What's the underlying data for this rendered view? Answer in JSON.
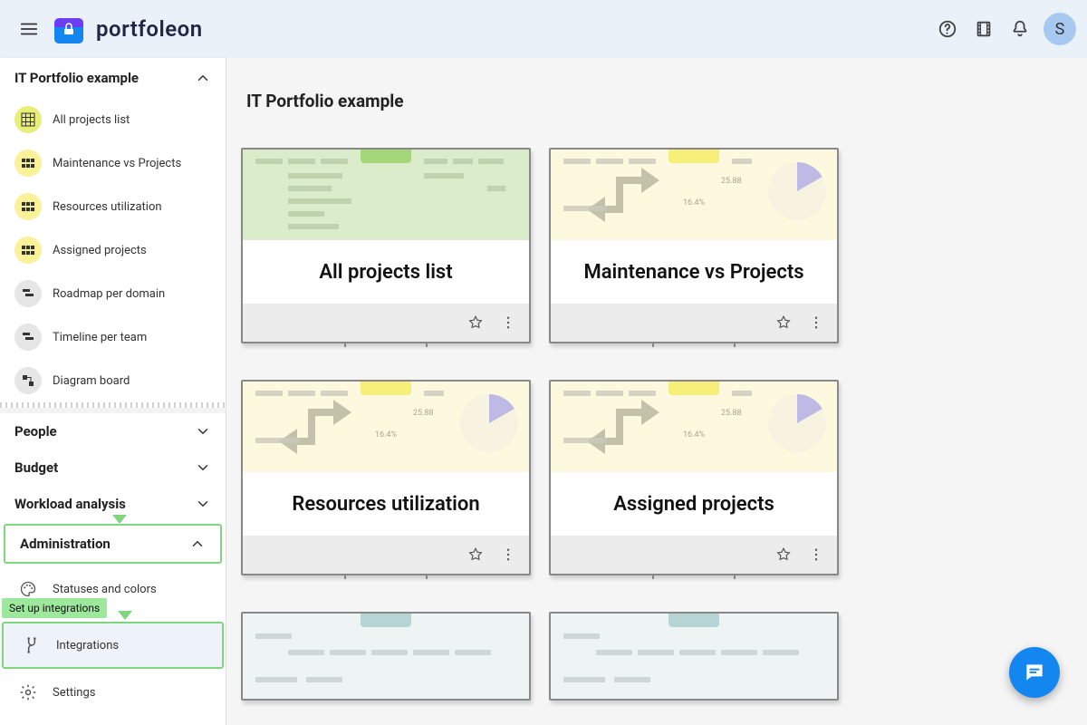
{
  "header": {
    "brand_text": "portfoleon",
    "avatar_initial": "S"
  },
  "sidebar": {
    "portfolio_section": {
      "title": "IT Portfolio example",
      "items": [
        {
          "label": "All projects list"
        },
        {
          "label": "Maintenance vs Projects"
        },
        {
          "label": "Resources utilization"
        },
        {
          "label": "Assigned projects"
        },
        {
          "label": "Roadmap per domain"
        },
        {
          "label": "Timeline per team"
        },
        {
          "label": "Diagram board"
        }
      ]
    },
    "sections": [
      {
        "title": "People"
      },
      {
        "title": "Budget"
      },
      {
        "title": "Workload analysis"
      }
    ],
    "admin_section": {
      "title": "Administration",
      "items": [
        {
          "label": "Statuses and colors"
        },
        {
          "label": "Integrations"
        },
        {
          "label": "Settings"
        }
      ]
    },
    "callout_text": "Set up integrations"
  },
  "main": {
    "title": "IT Portfolio example",
    "cards": [
      {
        "title": "All projects list",
        "thumb": "green"
      },
      {
        "title": "Maintenance vs Projects",
        "thumb": "yellow"
      },
      {
        "title": "Resources utilization",
        "thumb": "yellow"
      },
      {
        "title": "Assigned projects",
        "thumb": "yellow"
      }
    ],
    "partial_cards_thumb": "blue",
    "thumb_percent_a": "25.88",
    "thumb_percent_b": "16.4%"
  }
}
